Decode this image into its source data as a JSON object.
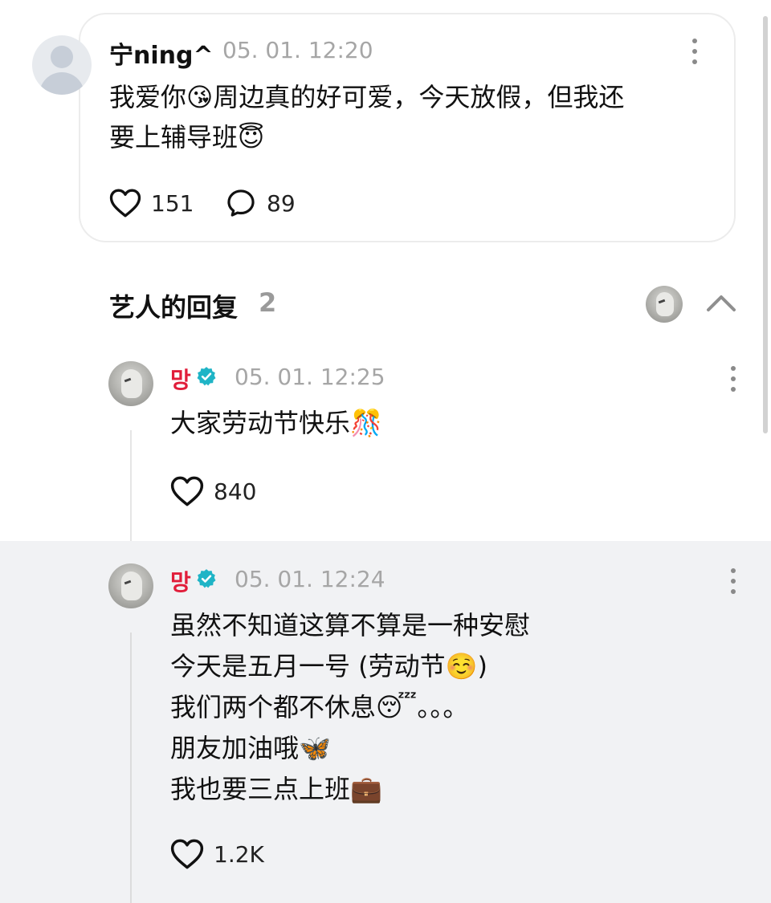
{
  "post": {
    "author": "宁ning^",
    "timestamp": "05. 01. 12:20",
    "text_line1": "我爱你😘周边真的好可爱，今天放假，但我还",
    "text_line2": "要上辅导班😇",
    "likes": "151",
    "replies": "89"
  },
  "artist_replies": {
    "title": "艺人的回复",
    "count": "2"
  },
  "replies": [
    {
      "author": "망",
      "timestamp": "05. 01. 12:25",
      "text": "大家劳动节快乐🎊",
      "likes": "840"
    },
    {
      "author": "망",
      "timestamp": "05. 01. 12:24",
      "lines": [
        "虽然不知道这算不算是一种安慰",
        "今天是五月一号 (劳动节☺️)",
        "我们两个都不休息😴。。。",
        "朋友加油哦🦋",
        "我也要三点上班💼"
      ],
      "likes": "1.2K"
    }
  ],
  "icons": {
    "like": "heart-icon",
    "reply": "comment-bubble-icon",
    "more": "more-vertical-icon",
    "verified": "verified-badge-icon",
    "collapse": "chevron-up-icon"
  },
  "colors": {
    "artist_name": "#e11d3a",
    "verified_badge": "#1fb4c6",
    "timestamp": "#a6a6a6",
    "highlight_bg": "#f1f2f4"
  }
}
